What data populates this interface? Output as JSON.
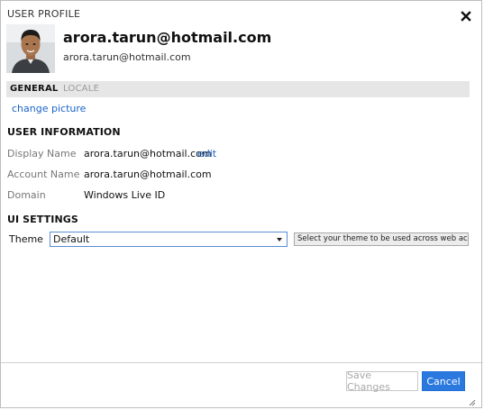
{
  "dialog": {
    "title": "USER PROFILE"
  },
  "profile": {
    "display_name": "arora.tarun@hotmail.com",
    "email": "arora.tarun@hotmail.com",
    "change_picture_label": "change picture"
  },
  "tabs": [
    {
      "label": "GENERAL",
      "active": true
    },
    {
      "label": "LOCALE",
      "active": false
    }
  ],
  "user_information": {
    "title": "USER INFORMATION",
    "rows": [
      {
        "label": "Display Name",
        "value": "arora.tarun@hotmail.com",
        "action": "edit"
      },
      {
        "label": "Account Name",
        "value": "arora.tarun@hotmail.com"
      },
      {
        "label": "Domain",
        "value": "Windows Live ID"
      }
    ]
  },
  "ui_settings": {
    "title": "UI SETTINGS",
    "theme_label": "Theme",
    "theme_value": "Default",
    "theme_hint": "Select your theme to be used across web access"
  },
  "footer": {
    "save_label": "Save Changes",
    "cancel_label": "Cancel"
  },
  "colors": {
    "link": "#1a64c8",
    "primary_button": "#2b79df",
    "tab_bar": "#e6e6e6",
    "select_border": "#5b8ed6"
  },
  "icons": {
    "close": "close-icon",
    "dropdown": "chevron-down-icon",
    "resize": "resize-grip-icon"
  }
}
